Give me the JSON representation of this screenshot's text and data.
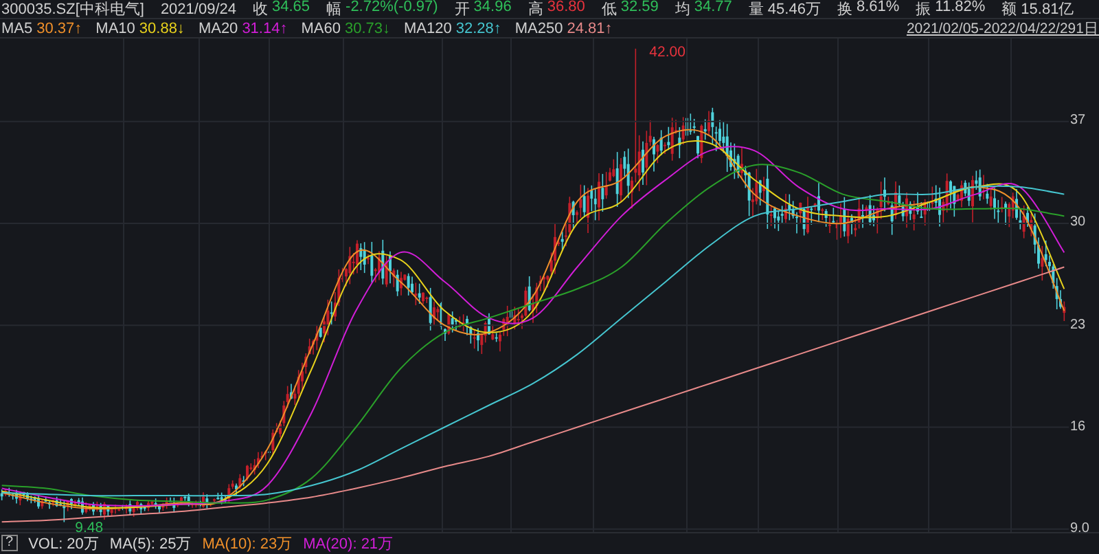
{
  "header": {
    "title": "300035.SZ[中科电气]",
    "date": "2021/09/24",
    "quotes": [
      {
        "label": "收",
        "value": "34.65",
        "color": "#2fbf5a"
      },
      {
        "label": "幅",
        "value": "-2.72%(-0.97)",
        "color": "#2fbf5a"
      },
      {
        "label": "开",
        "value": "34.96",
        "color": "#2fbf5a"
      },
      {
        "label": "高",
        "value": "36.80",
        "color": "#e8333d"
      },
      {
        "label": "低",
        "value": "32.59",
        "color": "#2fbf5a"
      },
      {
        "label": "均",
        "value": "34.77",
        "color": "#2fbf5a"
      },
      {
        "label": "量",
        "value": "45.46万",
        "color": "#d0d0d0"
      },
      {
        "label": "换",
        "value": "8.61%",
        "color": "#d0d0d0"
      },
      {
        "label": "振",
        "value": "11.82%",
        "color": "#d0d0d0"
      },
      {
        "label": "额",
        "value": "15.81亿",
        "color": "#d0d0d0"
      }
    ]
  },
  "ma_legend": [
    {
      "value": "30.37↑"
    },
    {
      "value": "30.88↓"
    },
    {
      "value": "31.14↑"
    },
    {
      "value": "30.73↓"
    },
    {
      "value": "32.28↑"
    },
    {
      "value": "24.81↑"
    }
  ],
  "range": "2021/02/05-2022/04/22/291日",
  "chart": {
    "high_label": "42.00",
    "low_label": "9.48",
    "chart_data": {
      "type": "line",
      "grid": true,
      "ylim": [
        8.8,
        42.7
      ],
      "yticks": [
        {
          "value": 37,
          "label": "37"
        },
        {
          "value": 30,
          "label": "30"
        },
        {
          "value": 23,
          "label": "23"
        },
        {
          "value": 16,
          "label": "16"
        },
        {
          "value": 9,
          "label": "9.0"
        }
      ],
      "series": [
        {
          "name": "MA5",
          "color": "#f0902a",
          "values": [
            11.5,
            10.8,
            10.4,
            10.5,
            10.8,
            11,
            14.5,
            21.5,
            28,
            26,
            23,
            22.5,
            25,
            31.5,
            33,
            36,
            36,
            32,
            30.5,
            30,
            31,
            31.5,
            32.5,
            31,
            24
          ]
        },
        {
          "name": "MA10",
          "color": "#e8d21c",
          "values": [
            11.6,
            11,
            10.5,
            10.5,
            10.7,
            11,
            13.5,
            20,
            27,
            27.5,
            24,
            22.5,
            24,
            30,
            31.5,
            35,
            35.5,
            33,
            31,
            30.5,
            30.5,
            31.5,
            32.5,
            32,
            25.5
          ]
        },
        {
          "name": "MA20",
          "color": "#d21ed8",
          "values": [
            11.8,
            11.2,
            10.7,
            10.6,
            10.7,
            10.9,
            12,
            17,
            24,
            28,
            26,
            23.5,
            23.5,
            27,
            30.5,
            33,
            35,
            35,
            32.5,
            31,
            31,
            31,
            32,
            32.5,
            28
          ]
        },
        {
          "name": "MA60",
          "color": "#2aa02a",
          "values": [
            12,
            11.8,
            11.3,
            11,
            10.9,
            10.8,
            11,
            12.5,
            16,
            20,
            22.5,
            23.5,
            24.5,
            25.5,
            27,
            30,
            32.5,
            34,
            33.5,
            32,
            31.5,
            31,
            31,
            31,
            30.5
          ]
        },
        {
          "name": "MA120",
          "color": "#46c6d0",
          "values": [
            11.5,
            11.4,
            11.3,
            11.3,
            11.3,
            11.3,
            11.4,
            12,
            13,
            14.5,
            16,
            17.5,
            19,
            21,
            23.5,
            26,
            28.5,
            30.5,
            31,
            31.5,
            32,
            32,
            32.5,
            32.5,
            32
          ]
        },
        {
          "name": "MA250",
          "color": "#e88a8a",
          "values": [
            9.5,
            9.6,
            9.8,
            10,
            10.2,
            10.5,
            10.8,
            11.2,
            11.8,
            12.5,
            13.3,
            14,
            15,
            16,
            17,
            18,
            19,
            20,
            21,
            22,
            23,
            24,
            25,
            26,
            27
          ]
        }
      ]
    }
  },
  "volume": {
    "help": "?",
    "items": [
      {
        "text": "VOL: 20万",
        "color": "#d8d8d8"
      },
      {
        "text": "MA(5): 25万",
        "color": "#d8d8d8"
      },
      {
        "text": "MA(10): 23万",
        "color": "#f0902a"
      },
      {
        "text": "MA(20): 21万",
        "color": "#d21ed8"
      }
    ]
  }
}
